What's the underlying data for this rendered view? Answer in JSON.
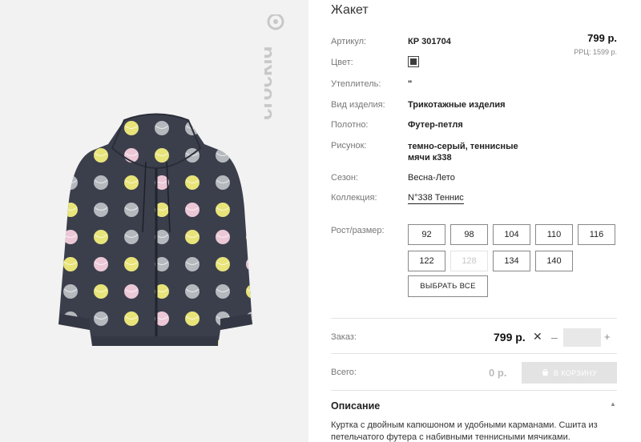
{
  "brand": {
    "name": "crockid"
  },
  "product": {
    "title": "Жакет",
    "price": "799 р.",
    "rrp": "РРЦ: 1599 р."
  },
  "attributes": [
    {
      "label": "Артикул:",
      "value": "КР 301704"
    },
    {
      "label": "Цвет:",
      "value": ""
    },
    {
      "label": "Утеплитель:",
      "value": "\""
    },
    {
      "label": "Вид изделия:",
      "value": "Трикотажные изделия"
    },
    {
      "label": "Полотно:",
      "value": "Футер-петля"
    },
    {
      "label": "Рисунок:",
      "value": "темно-серый, теннисные мячи к338"
    },
    {
      "label": "Сезон:",
      "value": "Весна-Лето"
    },
    {
      "label": "Коллекция:",
      "value": "N°338 Теннис"
    }
  ],
  "color_swatch": "#3d3d3d",
  "sizes": {
    "label": "Рост/размер:",
    "options": [
      "92",
      "98",
      "104",
      "110",
      "116",
      "122",
      "128",
      "134",
      "140"
    ],
    "disabled": [
      "128"
    ],
    "select_all": "ВЫБРАТЬ ВСЕ"
  },
  "order": {
    "label": "Заказ:",
    "price": "799 р.",
    "times": "✕",
    "minus": "–",
    "plus": "+",
    "quantity": ""
  },
  "total": {
    "label": "Всего:",
    "value": "0 р.",
    "cart_button": "В КОРЗИНУ"
  },
  "description": {
    "title": "Описание",
    "text": "Куртка с двойным капюшоном и удобными карманами. Сшита из петельчатого футера с набивными теннисными мячиками."
  },
  "colors": {
    "jacket": "#3b3f4c",
    "ball_yellow": "#e8e47a",
    "ball_gray": "#b5b9be",
    "ball_pink": "#ecc8d6",
    "cart_bg": "#e3e3e3"
  }
}
